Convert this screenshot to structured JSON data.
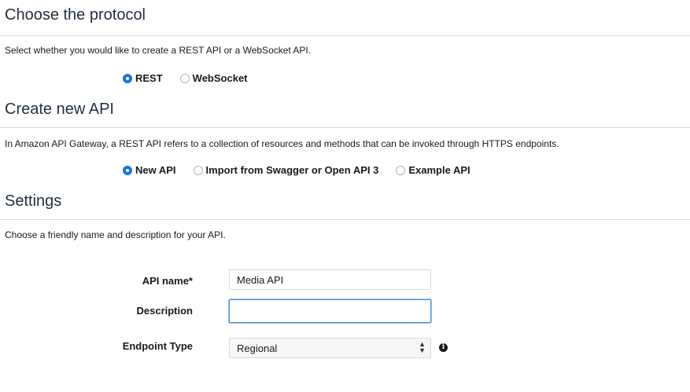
{
  "protocol": {
    "title": "Choose the protocol",
    "description": "Select whether you would like to create a REST API or a WebSocket API.",
    "options": [
      "REST",
      "WebSocket"
    ],
    "selected": "REST"
  },
  "create": {
    "title": "Create new API",
    "description": "In Amazon API Gateway, a REST API refers to a collection of resources and methods that can be invoked through HTTPS endpoints.",
    "options": [
      "New API",
      "Import from Swagger or Open API 3",
      "Example API"
    ],
    "selected": "New API"
  },
  "settings": {
    "title": "Settings",
    "description": "Choose a friendly name and description for your API.",
    "api_name_label": "API name*",
    "api_name_value": "Media API",
    "description_label": "Description",
    "description_value": "",
    "endpoint_type_label": "Endpoint Type",
    "endpoint_type_value": "Regional"
  },
  "icons": {
    "info": "info-icon",
    "select_arrows": "select-arrows-icon"
  }
}
